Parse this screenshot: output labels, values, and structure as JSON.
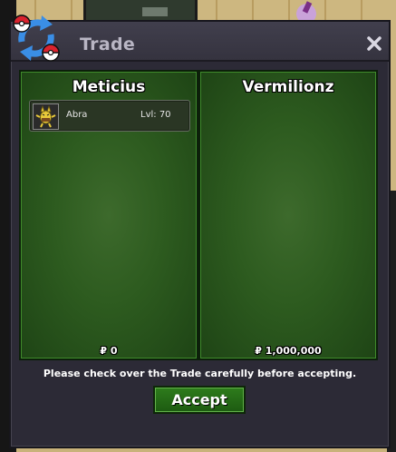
{
  "window": {
    "title": "Trade",
    "close_glyph": "✖"
  },
  "left_panel": {
    "trainer_name": "Meticius",
    "pokemon": [
      {
        "name": "Abra",
        "level": "Lvl: 70",
        "icon": "abra-sprite-icon"
      }
    ],
    "money": "₽ 0"
  },
  "right_panel": {
    "trainer_name": "Vermilionz",
    "pokemon": [],
    "money": "₽ 1,000,000"
  },
  "footer": {
    "notice": "Please check over the Trade carefully before accepting.",
    "accept_label": "Accept"
  },
  "colors": {
    "panel_green": "#2d5b1f",
    "window_bg": "#2c2a36",
    "accept_green": "#2e7c1c"
  }
}
